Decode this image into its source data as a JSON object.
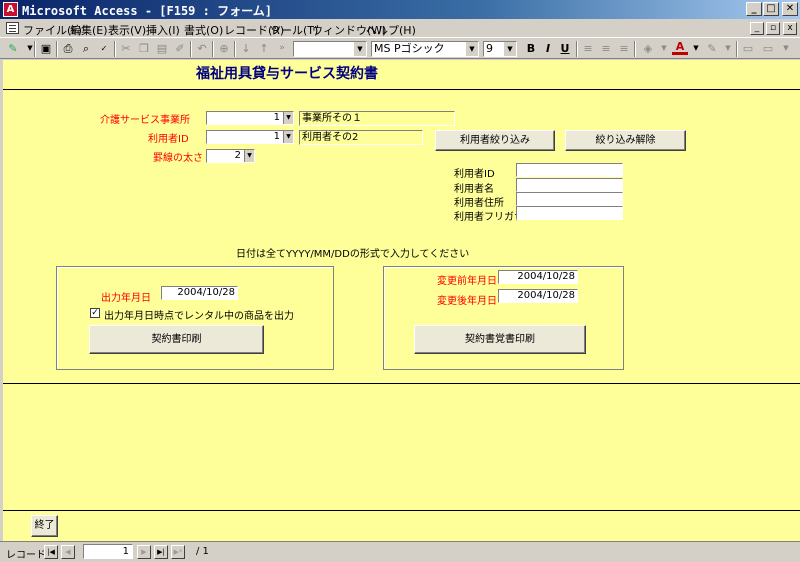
{
  "window": {
    "title": "Microsoft Access - [F159 : フォーム]",
    "app_icon_glyph": "A",
    "buttons": {
      "minimize": "_",
      "maximize": "□",
      "close": "✕"
    }
  },
  "menu": {
    "items": [
      "ファイル(F)",
      "編集(E)",
      "表示(V)",
      "挿入(I)",
      "書式(O)",
      "レコード(R)",
      "ツール(T)",
      "ウィンドウ(W)",
      "ヘルプ(H)"
    ],
    "mdi_buttons": {
      "minimize": "_",
      "restore": "▫",
      "close": "x"
    }
  },
  "toolbar": {
    "object_combo": "",
    "font_name": "MS Pゴシック",
    "font_size": "9",
    "bold": "B",
    "italic": "I",
    "underline": "U",
    "font_color_glyph": "A",
    "icons": [
      "view-icon",
      "save-icon",
      "print-icon",
      "print-preview-icon",
      "spelling-icon",
      "cut-icon",
      "copy-icon",
      "paste-icon",
      "format-painter-icon",
      "undo-icon",
      "insert-hyperlink-icon",
      "sort-ascending-icon",
      "sort-descending-icon",
      "align-left-icon",
      "align-center-icon",
      "align-right-icon",
      "fill-color-icon",
      "font-color-icon",
      "line-color-icon",
      "border-icon",
      "special-effect-icon"
    ]
  },
  "form": {
    "title": "福祉用具貸与サービス契約書",
    "office_label": "介護サービス事業所",
    "office_value": "1",
    "office_name": "事業所その１",
    "user_id_label": "利用者ID",
    "user_id_value": "1",
    "user_name": "利用者その2",
    "line_width_label": "罫線の太さ",
    "line_width_value": "2",
    "filter_button": "利用者絞り込み",
    "clear_filter_button": "絞り込み解除",
    "filter_fields": [
      {
        "label": "利用者ID",
        "value": ""
      },
      {
        "label": "利用者名",
        "value": ""
      },
      {
        "label": "利用者住所",
        "value": ""
      },
      {
        "label": "利用者フリガナ",
        "value": ""
      }
    ],
    "date_note": "日付は全てYYYY/MM/DDの形式で入力してください",
    "output_date_label": "出力年月日",
    "output_date_value": "2004/10/28",
    "rental_checkbox_label": "出力年月日時点でレンタル中の商品を出力",
    "rental_checked": true,
    "contract_print_button": "契約書印刷",
    "before_change_label": "変更前年月日",
    "before_change_value": "2004/10/28",
    "after_change_label": "変更後年月日",
    "after_change_value": "2004/10/28",
    "memo_print_button": "契約書覚書印刷",
    "exit_button": "終了"
  },
  "navigation": {
    "label": "レコード:",
    "current": "1",
    "total_text": "/ 1"
  },
  "colors": {
    "form_background": "#ffff99",
    "label_red": "#ff0000",
    "title_navy": "#000080"
  }
}
